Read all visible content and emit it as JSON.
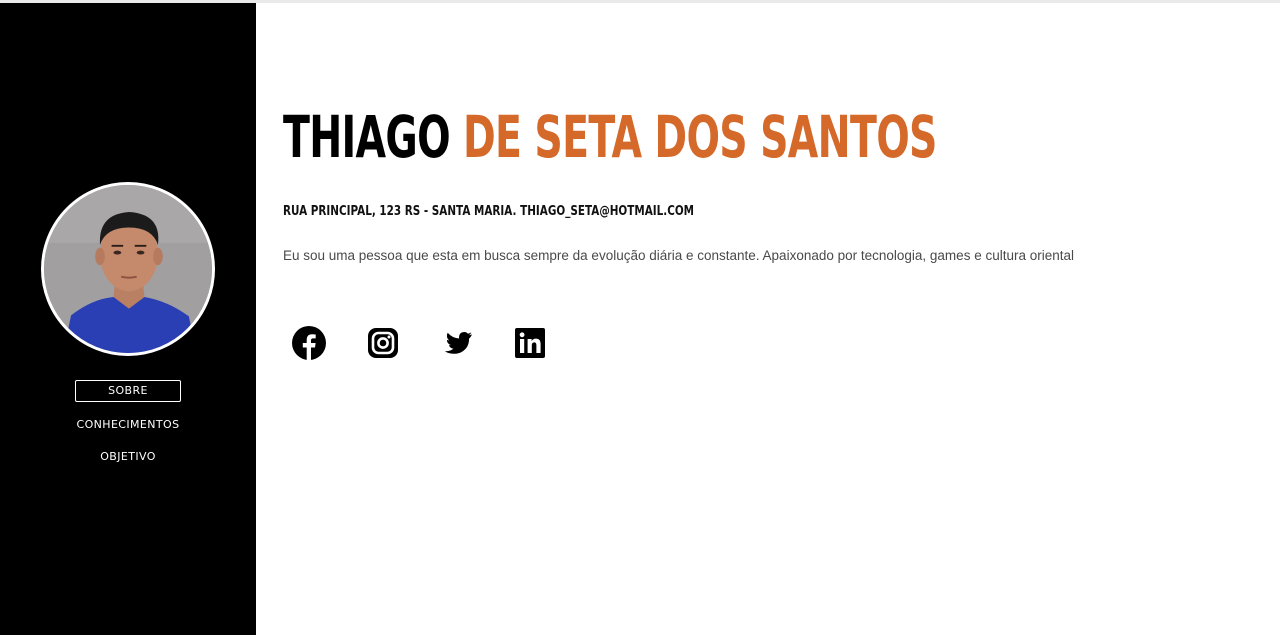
{
  "sidebar": {
    "nav": [
      {
        "label": "SOBRE",
        "active": true
      },
      {
        "label": "CONHECIMENTOS",
        "active": false
      },
      {
        "label": "OBJETIVO",
        "active": false
      }
    ]
  },
  "profile": {
    "first_name": "THIAGO",
    "last_name": "DE SETA DOS SANTOS",
    "address": "RUA PRINCIPAL, 123 RS - SANTA MARIA. THIAGO_SETA@HOTMAIL.COM",
    "bio": "Eu sou uma pessoa que esta em busca sempre da evolução diária e constante. Apaixonado por tecnologia, games e cultura oriental"
  },
  "socials": [
    {
      "icon": "facebook-icon"
    },
    {
      "icon": "instagram-icon"
    },
    {
      "icon": "twitter-icon"
    },
    {
      "icon": "linkedin-icon"
    }
  ],
  "colors": {
    "accent": "#d4692a",
    "sidebar": "#000000",
    "text": "#4a4a4a"
  }
}
